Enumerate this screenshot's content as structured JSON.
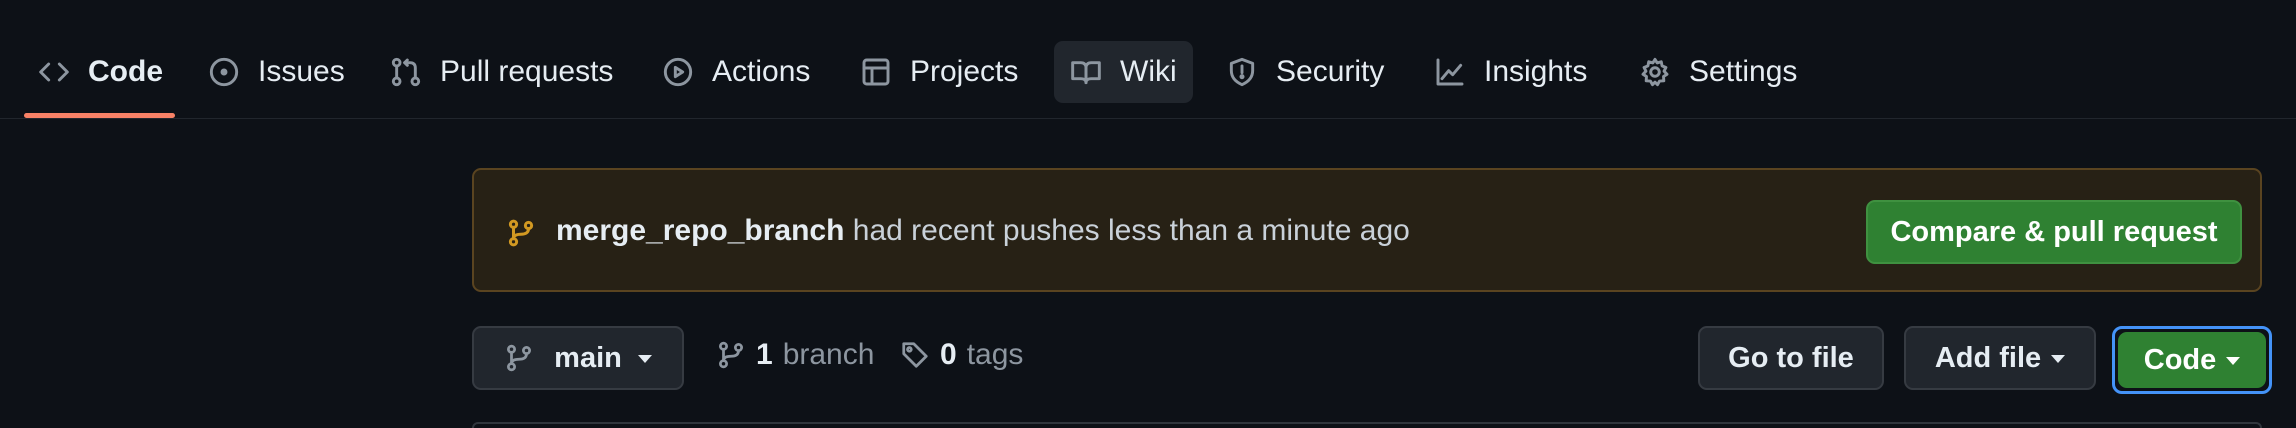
{
  "nav": {
    "tabs": [
      {
        "label": "Code",
        "icon": "code-icon",
        "selected": true
      },
      {
        "label": "Issues",
        "icon": "issue-opened-icon"
      },
      {
        "label": "Pull requests",
        "icon": "git-pull-request-icon"
      },
      {
        "label": "Actions",
        "icon": "play-icon"
      },
      {
        "label": "Projects",
        "icon": "table-icon"
      },
      {
        "label": "Wiki",
        "icon": "book-icon"
      },
      {
        "label": "Security",
        "icon": "shield-icon"
      },
      {
        "label": "Insights",
        "icon": "graph-icon"
      },
      {
        "label": "Settings",
        "icon": "gear-icon"
      }
    ],
    "accent_color": "#f78166"
  },
  "banner": {
    "branch_name": "merge_repo_branch",
    "message": "had recent pushes less than a minute ago",
    "compare_button_label": "Compare & pull request",
    "icon": "git-branch-icon"
  },
  "repo_bar": {
    "branch_selector_label": "main",
    "branch_count": "1",
    "branch_word": "branch",
    "tag_count": "0",
    "tag_word": "tags",
    "go_to_file_label": "Go to file",
    "add_file_label": "Add file",
    "code_button_label": "Code"
  },
  "colors": {
    "background": "#0d1117",
    "banner_bg": "#272115",
    "primary_button": "#2f8132",
    "focus": "#4493f8"
  }
}
